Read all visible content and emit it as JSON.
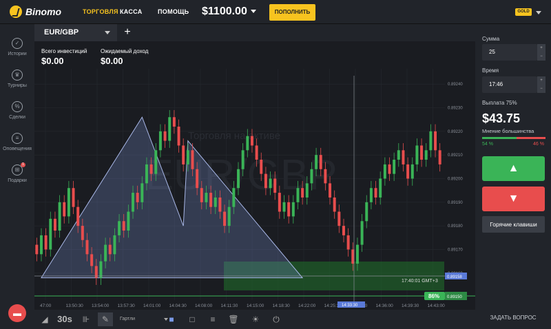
{
  "top": {
    "brand": "Binomo",
    "nav": [
      "ТОРГОВЛЯ",
      "КАССА",
      "ПОМОЩЬ"
    ],
    "balance": "$1100.00",
    "deposit": "ПОПОЛНИТЬ",
    "gold": "GOLD"
  },
  "sidebar": [
    {
      "label": "Истории",
      "icon": "check-icon",
      "glyph": "✓"
    },
    {
      "label": "Турниры",
      "icon": "trophy-icon",
      "glyph": "♛"
    },
    {
      "label": "Сделки",
      "icon": "percent-icon",
      "glyph": "%"
    },
    {
      "label": "Оповещения",
      "icon": "list-icon",
      "glyph": "≡"
    },
    {
      "label": "Подарки",
      "icon": "gift-icon",
      "glyph": "⊞",
      "badge": "1"
    }
  ],
  "tab": {
    "pair": "EUR/GBP",
    "add": "+"
  },
  "chart_info": {
    "invest_label": "Всего инвестиций",
    "invest": "$0.00",
    "income_label": "Ожидаемый доход",
    "income": "$0.00",
    "watermark_top": "Торговля на активе",
    "watermark": "EUR/GBP",
    "crosshair_time": "17:40:01 GMT+3",
    "cursor_price": "0.89158",
    "cursor_time": "14:33:30",
    "profit_pct": "86%",
    "current_price": "0.89150"
  },
  "bottom": {
    "timeframe": "30s",
    "drawing": "Гартли",
    "tool_glyphs": {
      "area": "◢",
      "candles": "⊪",
      "draw": "✎",
      "fill": "■",
      "rect": "□",
      "lines": "≡",
      "trash": "🗑",
      "sun": "☀",
      "plug": "⏻"
    }
  },
  "right": {
    "sum_label": "Сумма",
    "sum": "25",
    "time_label": "Время",
    "time": "17:46",
    "payout_label": "Выплата 75%",
    "payout": "$43.75",
    "majority_label": "Мнение большинства",
    "up_pct": "54 %",
    "down_pct": "46 %",
    "up_pct_value": 54,
    "hotkeys": "Горячие клавиши",
    "ask": "ЗАДАТЬ ВОПРОС",
    "up_glyph": "▲",
    "down_glyph": "▼",
    "plus": "+",
    "minus": "−"
  },
  "colors": {
    "accent": "#f7c31f",
    "up": "#3ab457",
    "down": "#e84d4d"
  },
  "chart_data": {
    "type": "candlestick",
    "price_ticks": [
      "0.89240",
      "0.89230",
      "0.89220",
      "0.89210",
      "0.89200",
      "0.89190",
      "0.89180",
      "0.89170",
      "0.89160"
    ],
    "time_ticks": [
      "47:00",
      "13:50:30",
      "13:54:00",
      "13:57:30",
      "14:01:00",
      "14:04:30",
      "14:08:00",
      "14:11:30",
      "14:15:00",
      "14:18:30",
      "14:22:00",
      "14:25:30",
      "14:29:00",
      "14:36:00",
      "14:39:30",
      "14:43:00"
    ],
    "candles": [
      [
        0.89172,
        0.89168
      ],
      [
        0.89168,
        0.89176
      ],
      [
        0.89176,
        0.8917
      ],
      [
        0.8917,
        0.89183
      ],
      [
        0.89183,
        0.89178
      ],
      [
        0.89178,
        0.8919
      ],
      [
        0.8919,
        0.89184
      ],
      [
        0.89184,
        0.89196
      ],
      [
        0.89196,
        0.89188
      ],
      [
        0.89188,
        0.8918
      ],
      [
        0.8918,
        0.89174
      ],
      [
        0.89174,
        0.89168
      ],
      [
        0.89168,
        0.89163
      ],
      [
        0.89163,
        0.89158
      ],
      [
        0.89158,
        0.89165
      ],
      [
        0.89165,
        0.89172
      ],
      [
        0.89172,
        0.89168
      ],
      [
        0.89168,
        0.89176
      ],
      [
        0.89176,
        0.89182
      ],
      [
        0.89182,
        0.89178
      ],
      [
        0.89178,
        0.89186
      ],
      [
        0.89186,
        0.89194
      ],
      [
        0.89194,
        0.8919
      ],
      [
        0.8919,
        0.89198
      ],
      [
        0.89198,
        0.89206
      ],
      [
        0.89206,
        0.89202
      ],
      [
        0.89202,
        0.89212
      ],
      [
        0.89212,
        0.8922
      ],
      [
        0.8922,
        0.89216
      ],
      [
        0.89216,
        0.89226
      ],
      [
        0.89226,
        0.89222
      ],
      [
        0.89222,
        0.89214
      ],
      [
        0.89214,
        0.89206
      ],
      [
        0.89206,
        0.89212
      ],
      [
        0.89212,
        0.89204
      ],
      [
        0.89204,
        0.89196
      ],
      [
        0.89196,
        0.8919
      ],
      [
        0.8919,
        0.89194
      ],
      [
        0.89194,
        0.89188
      ],
      [
        0.89188,
        0.89192
      ],
      [
        0.89192,
        0.89186
      ],
      [
        0.89186,
        0.8918
      ],
      [
        0.8918,
        0.89188
      ],
      [
        0.89188,
        0.89196
      ],
      [
        0.89196,
        0.89204
      ],
      [
        0.89204,
        0.89212
      ],
      [
        0.89212,
        0.89218
      ],
      [
        0.89218,
        0.89214
      ],
      [
        0.89214,
        0.89208
      ],
      [
        0.89208,
        0.89202
      ],
      [
        0.89202,
        0.89196
      ],
      [
        0.89196,
        0.892
      ],
      [
        0.892,
        0.89194
      ],
      [
        0.89194,
        0.89186
      ],
      [
        0.89186,
        0.8919
      ],
      [
        0.8919,
        0.89184
      ],
      [
        0.89184,
        0.8919
      ],
      [
        0.8919,
        0.89196
      ],
      [
        0.89196,
        0.89192
      ],
      [
        0.89192,
        0.89198
      ],
      [
        0.89198,
        0.89204
      ],
      [
        0.89204,
        0.8921
      ],
      [
        0.8921,
        0.89204
      ],
      [
        0.89204,
        0.89198
      ],
      [
        0.89198,
        0.89192
      ],
      [
        0.89192,
        0.89186
      ],
      [
        0.89186,
        0.8918
      ],
      [
        0.8918,
        0.89176
      ],
      [
        0.89176,
        0.8917
      ],
      [
        0.8917,
        0.89164
      ],
      [
        0.89164,
        0.89172
      ],
      [
        0.89172,
        0.89182
      ],
      [
        0.89182,
        0.8919
      ],
      [
        0.8919,
        0.89196
      ],
      [
        0.89196,
        0.89192
      ],
      [
        0.89192,
        0.892
      ],
      [
        0.892,
        0.89206
      ],
      [
        0.89206,
        0.89202
      ],
      [
        0.89202,
        0.89208
      ],
      [
        0.89208,
        0.89212
      ],
      [
        0.89212,
        0.89206
      ],
      [
        0.89206,
        0.892
      ],
      [
        0.892,
        0.89206
      ],
      [
        0.89206,
        0.89214
      ],
      [
        0.89214,
        0.89208
      ],
      [
        0.89208,
        0.89212
      ],
      [
        0.89212,
        0.8922
      ],
      [
        0.8922,
        0.89212
      ],
      [
        0.89212,
        0.89206
      ]
    ],
    "pattern_points": [
      [
        1,
        0.89158
      ],
      [
        23,
        0.89226
      ],
      [
        32,
        0.8918
      ],
      [
        33,
        0.89216
      ],
      [
        58,
        0.89158
      ]
    ],
    "ylim": [
      0.89148,
      0.89245
    ]
  }
}
